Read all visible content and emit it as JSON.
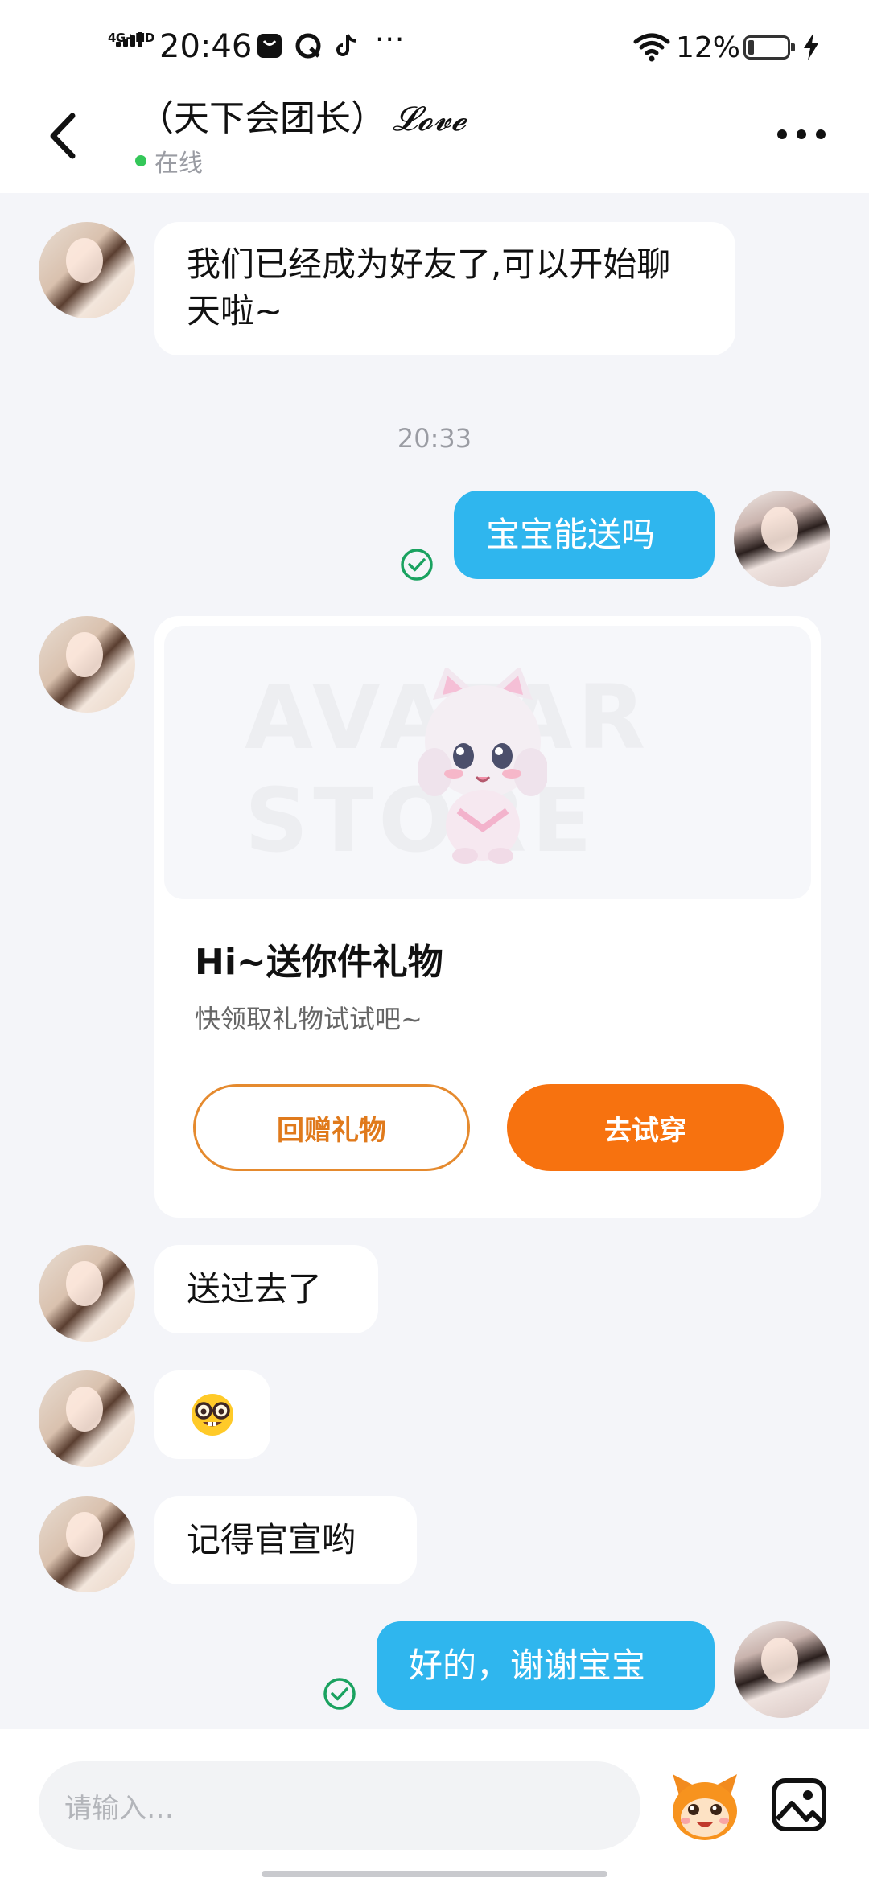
{
  "status_bar": {
    "network": "4G+HD",
    "time": "20:46",
    "notification_icons": [
      "bag-icon",
      "qq-browser-icon",
      "tiktok-icon"
    ],
    "more_notifications": "···",
    "battery_percent": "12%",
    "charging": true
  },
  "header": {
    "title": "（天下会团长）",
    "title_script": "𝓛𝓸𝓿𝓮",
    "status": "在线"
  },
  "messages": [
    {
      "side": "left",
      "type": "text",
      "text": "我们已经成为好友了,可以开始聊天啦~"
    },
    {
      "type": "timestamp",
      "text": "20:33"
    },
    {
      "side": "right",
      "type": "text",
      "text": "宝宝能送吗",
      "read": true
    },
    {
      "side": "left",
      "type": "gift",
      "watermark": "AVATAR STORE",
      "title": "Hi~送你件礼物",
      "subtitle": "快领取礼物试试吧~",
      "return_label": "回赠礼物",
      "try_label": "去试穿"
    },
    {
      "side": "left",
      "type": "text",
      "text": "送过去了"
    },
    {
      "side": "left",
      "type": "emoji",
      "text": "🤓"
    },
    {
      "side": "left",
      "type": "text",
      "text": "记得官宣哟"
    },
    {
      "side": "right",
      "type": "text",
      "text": "好的，谢谢宝宝",
      "read": true
    }
  ],
  "input": {
    "placeholder": "请输入…"
  },
  "colors": {
    "outgoing_bubble": "#2fb6ee",
    "incoming_bubble": "#ffffff",
    "chat_background": "#f4f5f9",
    "read_check": "#1aa260",
    "gift_primary": "#f7720f",
    "online_dot": "#34c759"
  }
}
